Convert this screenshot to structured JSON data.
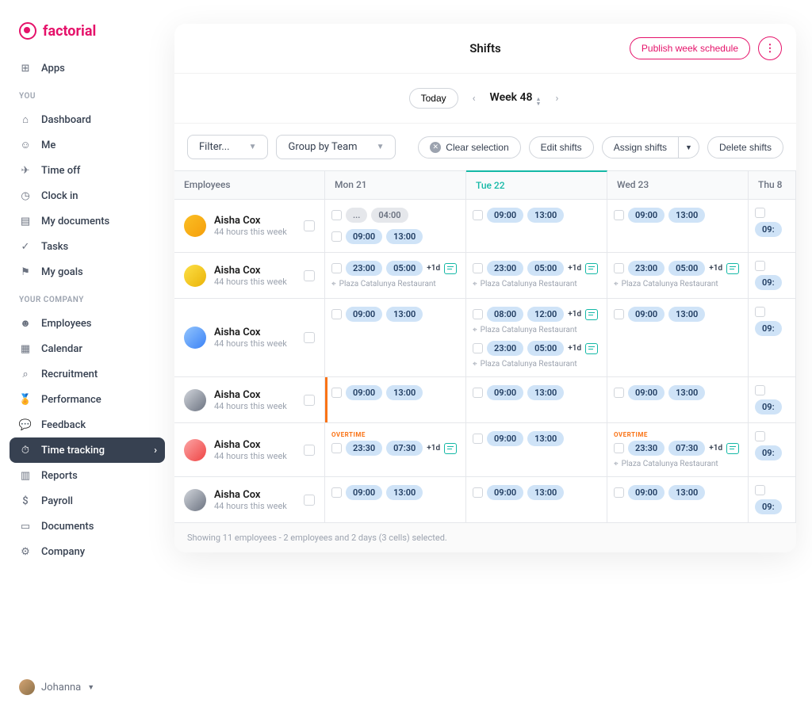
{
  "brand": "factorial",
  "nav": {
    "apps": "Apps",
    "section_you": "YOU",
    "dashboard": "Dashboard",
    "me": "Me",
    "timeoff": "Time off",
    "clockin": "Clock in",
    "mydocs": "My documents",
    "tasks": "Tasks",
    "mygoals": "My goals",
    "section_company": "YOUR COMPANY",
    "employees": "Employees",
    "calendar": "Calendar",
    "recruitment": "Recruitment",
    "performance": "Performance",
    "feedback": "Feedback",
    "timetracking": "Time tracking",
    "reports": "Reports",
    "payroll": "Payroll",
    "documents": "Documents",
    "company": "Company"
  },
  "user": {
    "name": "Johanna"
  },
  "header": {
    "title": "Shifts",
    "publish": "Publish week schedule"
  },
  "weeknav": {
    "today": "Today",
    "label": "Week 48"
  },
  "toolbar": {
    "filter": "Filter...",
    "groupby": "Group by Team",
    "clear": "Clear selection",
    "edit": "Edit shifts",
    "assign": "Assign shifts",
    "delete": "Delete shifts"
  },
  "columns": {
    "emp": "Employees",
    "mon": "Mon 21",
    "tue": "Tue 22",
    "wed": "Wed 23",
    "thu": "Thu 8"
  },
  "emp": {
    "name": "Aisha Cox",
    "sub": "44 hours this week"
  },
  "times": {
    "dots": "...",
    "t0400": "04:00",
    "t0500": "05:00",
    "t0730": "07:30",
    "t0800": "08:00",
    "t0900": "09:00",
    "t09p": "09:",
    "t1200": "12:00",
    "t1300": "13:00",
    "t2300": "23:00",
    "t2330": "23:30",
    "plus1d": "+1d"
  },
  "labels": {
    "location": "Plaza Catalunya Restaurant",
    "overtime": "OVERTIME"
  },
  "footer": "Showing 11 employees  -  2 employees and 2 days (3 cells) selected."
}
